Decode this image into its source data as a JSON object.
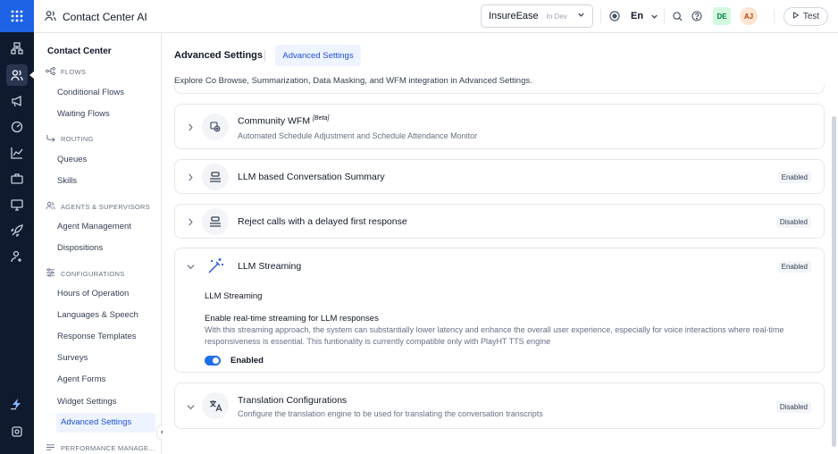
{
  "app": {
    "title": "Contact Center AI"
  },
  "header": {
    "env_name": "InsureEase",
    "env_tag": "In Dev",
    "language": "En",
    "avatars": [
      {
        "initials": "DE",
        "bg": "#d1fadf",
        "fg": "#067647"
      },
      {
        "initials": "AJ",
        "bg": "#fde5d2",
        "fg": "#b54708"
      }
    ],
    "test_label": "Test"
  },
  "sidebar": {
    "title": "Contact Center",
    "sections": [
      {
        "label": "FLOWS",
        "icon": "flow-icon",
        "items": [
          "Conditional Flows",
          "Waiting Flows"
        ]
      },
      {
        "label": "ROUTING",
        "icon": "routing-icon",
        "items": [
          "Queues",
          "Skills"
        ]
      },
      {
        "label": "AGENTS & SUPERVISORS",
        "icon": "agents-icon",
        "items": [
          "Agent Management",
          "Dispositions"
        ]
      },
      {
        "label": "CONFIGURATIONS",
        "icon": "config-icon",
        "items": [
          "Hours of Operation",
          "Languages & Speech",
          "Response Templates",
          "Surveys",
          "Agent Forms",
          "Widget Settings",
          "Advanced Settings"
        ]
      },
      {
        "label": "PERFORMANCE MANAGE...",
        "icon": "performance-icon",
        "items": []
      }
    ],
    "active_item": "Advanced Settings"
  },
  "page": {
    "title": "Advanced Settings",
    "tab": "Advanced Settings",
    "description": "Explore Co Browse, Summarization, Data Masking, and WFM integration in Advanced Settings."
  },
  "cards": [
    {
      "title": "Community WFM",
      "tag": "[Beta]",
      "subtitle": "Automated Schedule Adjustment and Schedule Attendance Monitor",
      "badge": "",
      "icon": "gear-stack-icon",
      "expanded": false
    },
    {
      "title": "LLM based Conversation Summary",
      "tag": "",
      "subtitle": "",
      "badge": "Enabled",
      "icon": "layers-icon",
      "expanded": false
    },
    {
      "title": "Reject calls with a delayed first response",
      "tag": "",
      "subtitle": "",
      "badge": "Disabled",
      "icon": "layers-icon",
      "expanded": false
    },
    {
      "title": "LLM Streaming",
      "tag": "",
      "subtitle": "",
      "badge": "Enabled",
      "icon": "magic-wand-icon",
      "expanded": true
    },
    {
      "title": "Translation Configurations",
      "tag": "",
      "subtitle": "Configure the translation engine to be used for translating the conversation transcripts",
      "badge": "Disabled",
      "icon": "translate-icon",
      "expanded": false
    }
  ],
  "llm_streaming": {
    "heading": "LLM Streaming",
    "toggle_title": "Enable real-time streaming for LLM responses",
    "toggle_desc": "With this streaming approach, the system can substantially lower latency and enhance the overall user experience, especially for voice interactions where real-time responsiveness is essential. This funtionality is currently compatible only with PlayHT TTS engine",
    "toggle_on": true,
    "toggle_label": "Enabled"
  },
  "colors": {
    "rail": "#0f1a2e",
    "accent": "#1d4ed8",
    "apps": "#1e62e6"
  }
}
